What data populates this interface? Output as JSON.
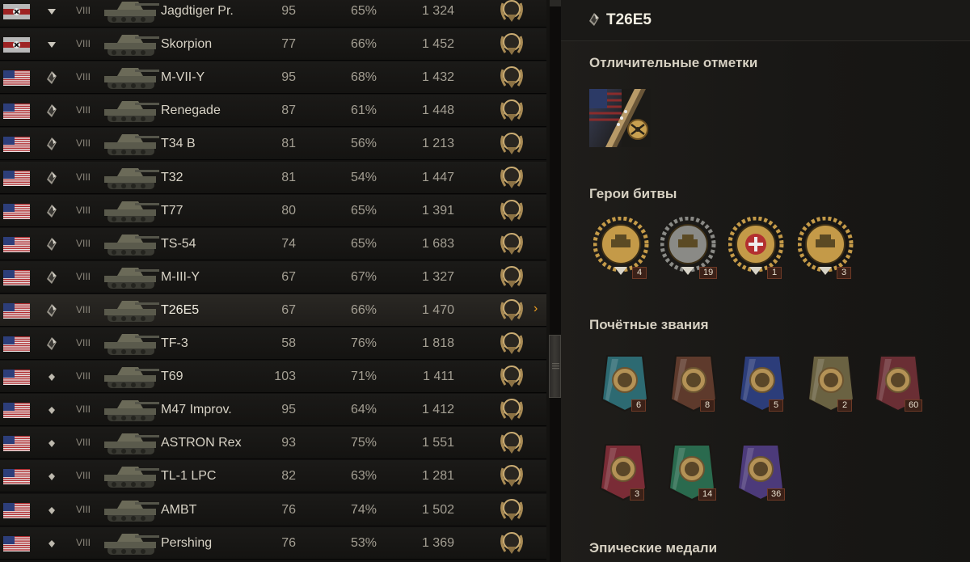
{
  "vehicles": [
    {
      "nation": "germany",
      "type": "td",
      "tier": "VIII",
      "name": "Jagdtiger Pr.",
      "battles": "95",
      "winrate": "65%",
      "avg_xp": "1 324",
      "mastery": "M",
      "selected": false
    },
    {
      "nation": "germany",
      "type": "td",
      "tier": "VIII",
      "name": "Skorpion",
      "battles": "77",
      "winrate": "66%",
      "avg_xp": "1 452",
      "mastery": "M",
      "selected": false
    },
    {
      "nation": "usa",
      "type": "heavy",
      "tier": "VIII",
      "name": "M-VII-Y",
      "battles": "95",
      "winrate": "68%",
      "avg_xp": "1 432",
      "mastery": "M",
      "selected": false
    },
    {
      "nation": "usa",
      "type": "heavy",
      "tier": "VIII",
      "name": "Renegade",
      "battles": "87",
      "winrate": "61%",
      "avg_xp": "1 448",
      "mastery": "M",
      "selected": false
    },
    {
      "nation": "usa",
      "type": "heavy",
      "tier": "VIII",
      "name": "T34 B",
      "battles": "81",
      "winrate": "56%",
      "avg_xp": "1 213",
      "mastery": "M",
      "selected": false
    },
    {
      "nation": "usa",
      "type": "heavy",
      "tier": "VIII",
      "name": "T32",
      "battles": "81",
      "winrate": "54%",
      "avg_xp": "1 447",
      "mastery": "M",
      "selected": false
    },
    {
      "nation": "usa",
      "type": "heavy",
      "tier": "VIII",
      "name": "T77",
      "battles": "80",
      "winrate": "65%",
      "avg_xp": "1 391",
      "mastery": "M",
      "selected": false
    },
    {
      "nation": "usa",
      "type": "heavy",
      "tier": "VIII",
      "name": "TS-54",
      "battles": "74",
      "winrate": "65%",
      "avg_xp": "1 683",
      "mastery": "M",
      "selected": false
    },
    {
      "nation": "usa",
      "type": "heavy",
      "tier": "VIII",
      "name": "M-III-Y",
      "battles": "67",
      "winrate": "67%",
      "avg_xp": "1 327",
      "mastery": "M",
      "selected": false
    },
    {
      "nation": "usa",
      "type": "heavy",
      "tier": "VIII",
      "name": "T26E5",
      "battles": "67",
      "winrate": "66%",
      "avg_xp": "1 470",
      "mastery": "M",
      "selected": true
    },
    {
      "nation": "usa",
      "type": "heavy",
      "tier": "VIII",
      "name": "TF-3",
      "battles": "58",
      "winrate": "76%",
      "avg_xp": "1 818",
      "mastery": "M",
      "selected": false
    },
    {
      "nation": "usa",
      "type": "medium",
      "tier": "VIII",
      "name": "T69",
      "battles": "103",
      "winrate": "71%",
      "avg_xp": "1 411",
      "mastery": "M",
      "selected": false
    },
    {
      "nation": "usa",
      "type": "medium",
      "tier": "VIII",
      "name": "M47 Improv.",
      "battles": "95",
      "winrate": "64%",
      "avg_xp": "1 412",
      "mastery": "M",
      "selected": false
    },
    {
      "nation": "usa",
      "type": "medium",
      "tier": "VIII",
      "name": "ASTRON Rex",
      "battles": "93",
      "winrate": "75%",
      "avg_xp": "1 551",
      "mastery": "M",
      "selected": false
    },
    {
      "nation": "usa",
      "type": "medium",
      "tier": "VIII",
      "name": "TL-1 LPC",
      "battles": "82",
      "winrate": "63%",
      "avg_xp": "1 281",
      "mastery": "M",
      "selected": false
    },
    {
      "nation": "usa",
      "type": "medium",
      "tier": "VIII",
      "name": "AMBT",
      "battles": "76",
      "winrate": "74%",
      "avg_xp": "1 502",
      "mastery": "M",
      "selected": false
    },
    {
      "nation": "usa",
      "type": "medium",
      "tier": "VIII",
      "name": "Pershing",
      "battles": "76",
      "winrate": "53%",
      "avg_xp": "1 369",
      "mastery": "M",
      "selected": false
    }
  ],
  "selection_arrow": "›",
  "detail": {
    "title": "T26E5",
    "sections": {
      "marks": "Отличительные отметки",
      "heroes": "Герои битвы",
      "honors": "Почётные звания",
      "epic": "Эпические медали"
    },
    "heroes": [
      {
        "icon": "tank-gold-medal-icon",
        "count": "4"
      },
      {
        "icon": "tank-silver-wreath-icon",
        "count": "19"
      },
      {
        "icon": "shield-cross-medal-icon",
        "count": "1"
      },
      {
        "icon": "tank-gold-emblem-icon",
        "count": "3"
      }
    ],
    "honors_row1": [
      {
        "icon": "sword-teal-ribbon-icon",
        "count": "6"
      },
      {
        "icon": "tank-brown-ribbon-icon",
        "count": "8"
      },
      {
        "icon": "tower-blue-ribbon-icon",
        "count": "5"
      },
      {
        "icon": "chevron-olive-ribbon-icon",
        "count": "2"
      },
      {
        "icon": "cross-red-ribbon-icon",
        "count": "60"
      }
    ],
    "honors_row2": [
      {
        "icon": "knife-red-ribbon-icon",
        "count": "3"
      },
      {
        "icon": "wheat-green-ribbon-icon",
        "count": "14"
      },
      {
        "icon": "wreath-purple-ribbon-icon",
        "count": "36"
      }
    ]
  },
  "colors": {
    "accent": "#f0a020",
    "badge_bg": "#3b2118",
    "text": "#d6d0c2"
  }
}
